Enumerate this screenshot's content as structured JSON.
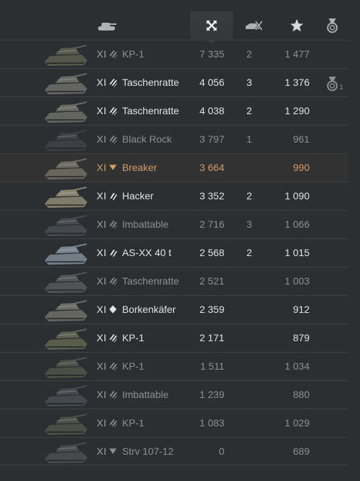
{
  "header": {
    "columns": [
      {
        "icon": "tank-type-icon",
        "sorted": false
      },
      {
        "icon": "damage-crossed-swords-icon",
        "sorted": true
      },
      {
        "icon": "kills-destroyed-tank-icon",
        "sorted": false
      },
      {
        "icon": "experience-star-icon",
        "sorted": false
      },
      {
        "icon": "medal-icon",
        "sorted": false
      }
    ]
  },
  "colors": {
    "alive": "#e3e3e3",
    "dead": "#8d9093",
    "player": "#d79d65",
    "background": "#2c2f31"
  },
  "rows": [
    {
      "tier": "XI",
      "class": "heavy",
      "name": "KP-1",
      "damage": "7 335",
      "kills": "2",
      "xp": "1 477",
      "status": "dead",
      "medal": "",
      "tank_color": "#5a5c4e"
    },
    {
      "tier": "XI",
      "class": "heavy",
      "name": "Taschenratte",
      "damage": "4 056",
      "kills": "3",
      "xp": "1 376",
      "status": "alive",
      "medal": "1",
      "tank_color": "#6a6a66"
    },
    {
      "tier": "XI",
      "class": "heavy",
      "name": "Taschenratte",
      "damage": "4 038",
      "kills": "2",
      "xp": "1 290",
      "status": "alive",
      "medal": "",
      "tank_color": "#6a6a66"
    },
    {
      "tier": "XI",
      "class": "heavy",
      "name": "Black Rock",
      "damage": "3 797",
      "kills": "1",
      "xp": "961",
      "status": "dead",
      "medal": "",
      "tank_color": "#3e4146"
    },
    {
      "tier": "XI",
      "class": "td",
      "name": "Breaker",
      "damage": "3 664",
      "kills": "",
      "xp": "990",
      "status": "player",
      "medal": "",
      "tank_color": "#6e6a62"
    },
    {
      "tier": "XI",
      "class": "medium",
      "name": "Hacker",
      "damage": "3 352",
      "kills": "2",
      "xp": "1 090",
      "status": "alive",
      "medal": "",
      "tank_color": "#8a8570"
    },
    {
      "tier": "XI",
      "class": "heavy",
      "name": "Imbattable",
      "damage": "2 716",
      "kills": "3",
      "xp": "1 066",
      "status": "dead",
      "medal": "",
      "tank_color": "#464c52"
    },
    {
      "tier": "XI",
      "class": "medium",
      "name": "AS-XX 40 t",
      "damage": "2 568",
      "kills": "2",
      "xp": "1 015",
      "status": "alive",
      "medal": "",
      "tank_color": "#7a8690"
    },
    {
      "tier": "XI",
      "class": "heavy",
      "name": "Taschenratte",
      "damage": "2 521",
      "kills": "",
      "xp": "1 003",
      "status": "dead",
      "medal": "",
      "tank_color": "#55565a"
    },
    {
      "tier": "XI",
      "class": "light",
      "name": "Borkenkäfer",
      "damage": "2 359",
      "kills": "",
      "xp": "912",
      "status": "alive",
      "medal": "",
      "tank_color": "#6c6c68"
    },
    {
      "tier": "XI",
      "class": "heavy",
      "name": "KP-1",
      "damage": "2 171",
      "kills": "",
      "xp": "879",
      "status": "alive",
      "medal": "",
      "tank_color": "#5f6250"
    },
    {
      "tier": "XI",
      "class": "heavy",
      "name": "KP-1",
      "damage": "1 511",
      "kills": "",
      "xp": "1 034",
      "status": "dead",
      "medal": "",
      "tank_color": "#4f5248"
    },
    {
      "tier": "XI",
      "class": "heavy",
      "name": "Imbattable",
      "damage": "1 239",
      "kills": "",
      "xp": "880",
      "status": "dead",
      "medal": "",
      "tank_color": "#464c52"
    },
    {
      "tier": "XI",
      "class": "heavy",
      "name": "KP-1",
      "damage": "1 083",
      "kills": "",
      "xp": "1 029",
      "status": "dead",
      "medal": "",
      "tank_color": "#4f5248"
    },
    {
      "tier": "XI",
      "class": "td",
      "name": "Strv 107-12",
      "damage": "0",
      "kills": "",
      "xp": "689",
      "status": "dead",
      "medal": "",
      "tank_color": "#4a4d4e"
    }
  ]
}
